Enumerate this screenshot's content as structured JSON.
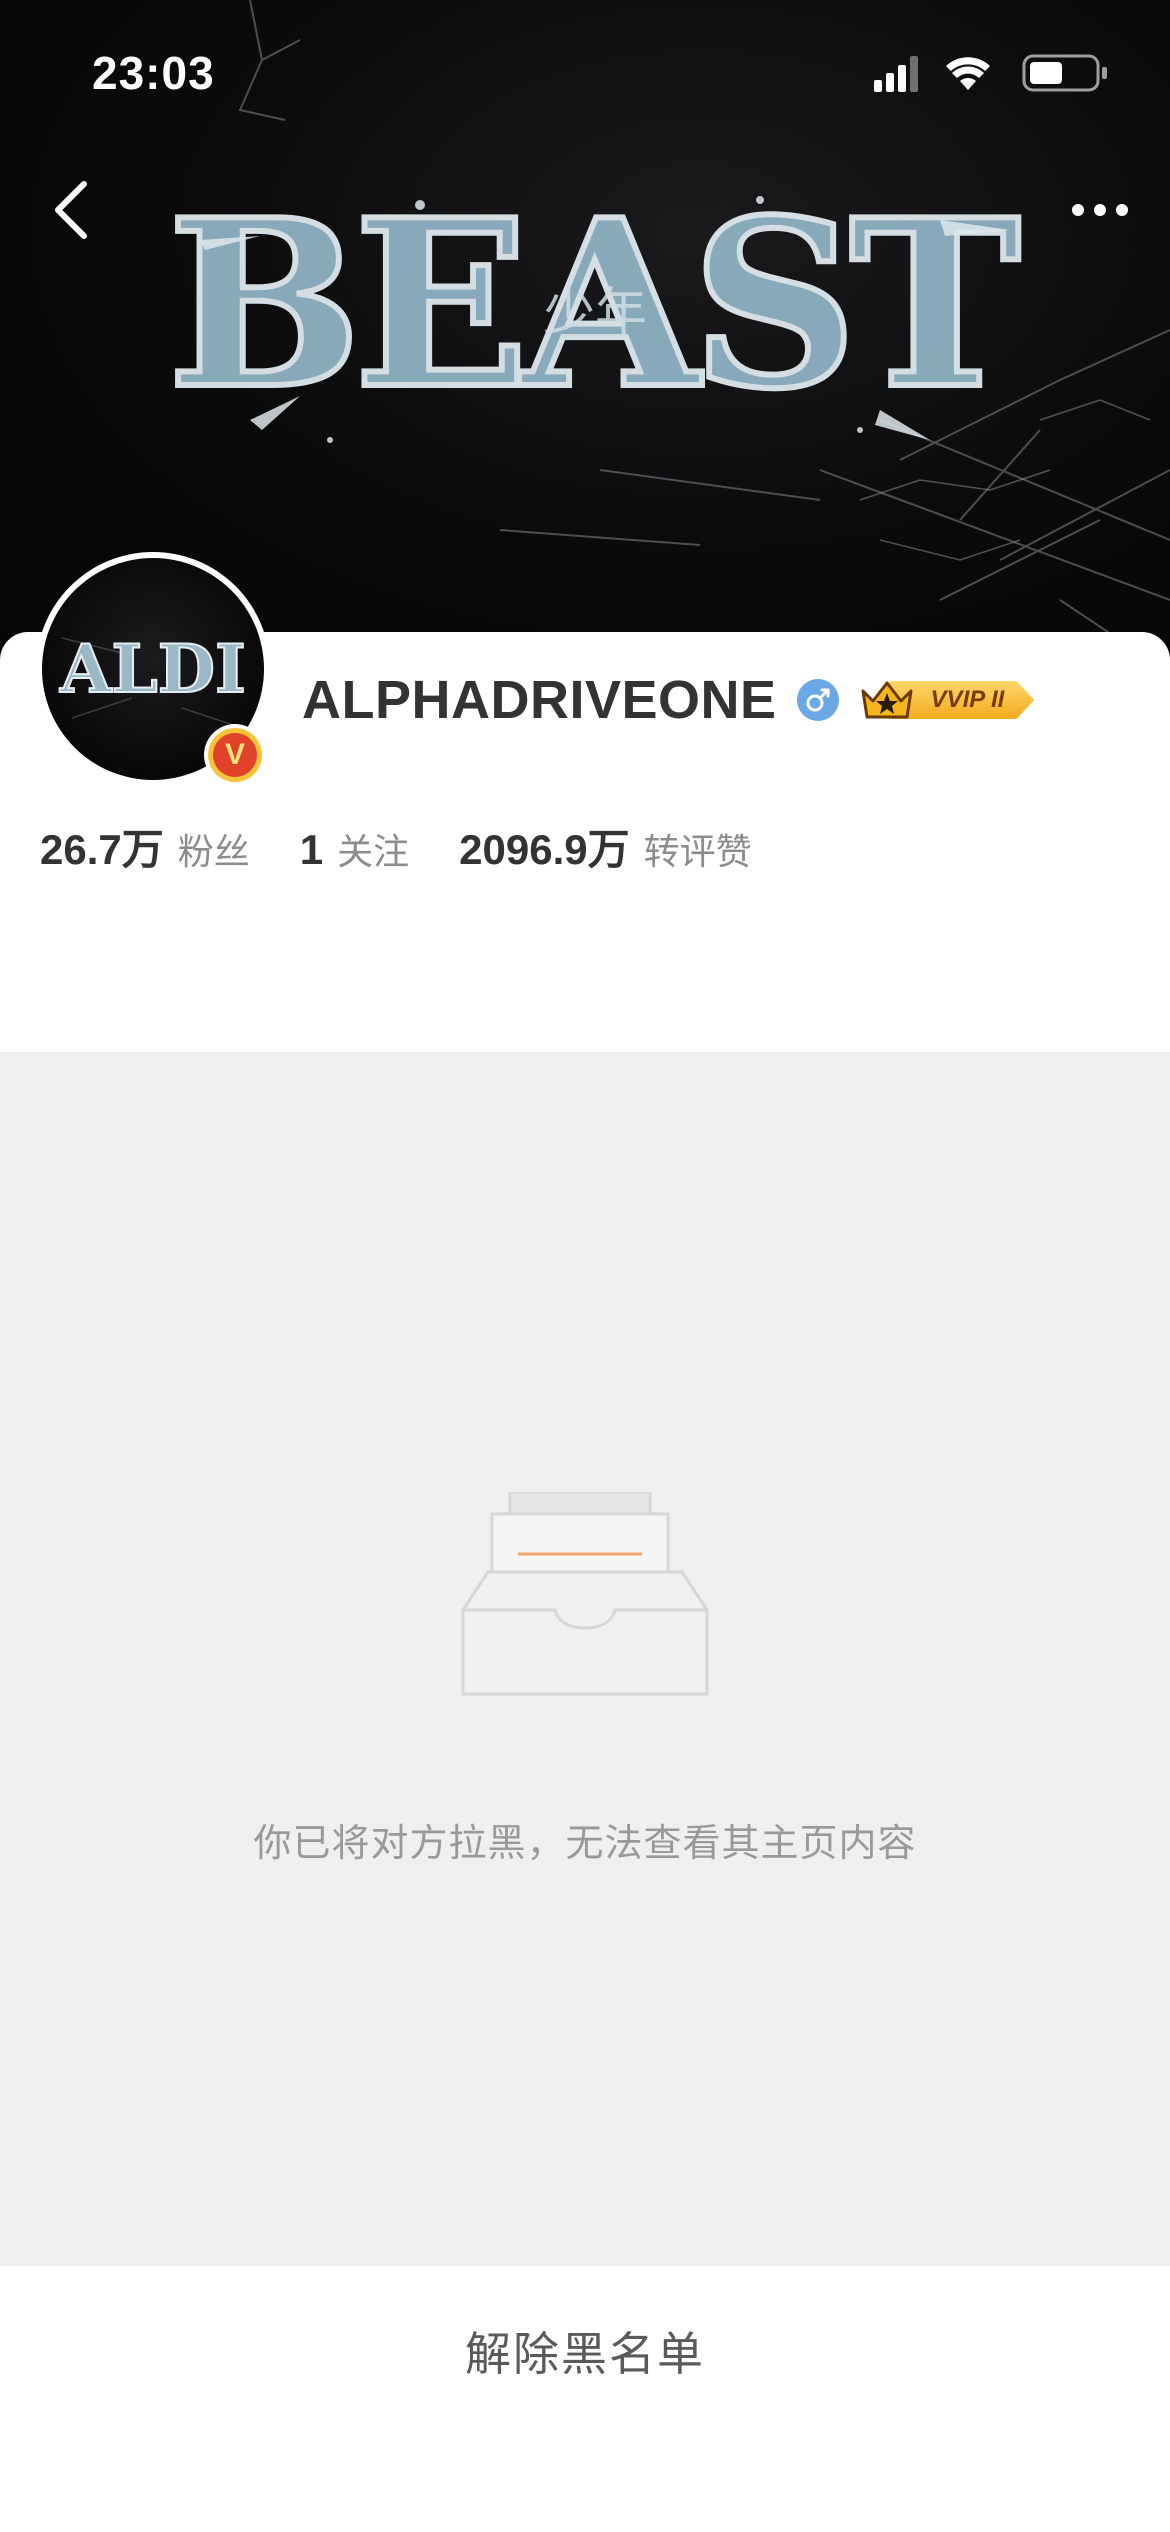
{
  "status_bar": {
    "time": "23:03",
    "icons": [
      "signal-icon",
      "wifi-icon",
      "battery-icon"
    ]
  },
  "nav": {
    "back_icon": "chevron-left-icon",
    "more_icon": "more-dots-icon"
  },
  "banner": {
    "artwork_text": "BEAST",
    "artwork_subtext": "少年"
  },
  "profile": {
    "avatar_text": "ALDI",
    "verified_badge": "V",
    "username": "ALPHADRIVEONE",
    "gender_icon": "male-icon",
    "vip_label": "VVIP II",
    "stats": [
      {
        "value": "26.7万",
        "label": "粉丝"
      },
      {
        "value": "1",
        "label": "关注"
      },
      {
        "value": "2096.9万",
        "label": "转评赞"
      }
    ]
  },
  "blocked": {
    "illustration_icon": "empty-inbox-icon",
    "message": "你已将对方拉黑，无法查看其主页内容"
  },
  "actions": {
    "unblock_label": "解除黑名单"
  },
  "colors": {
    "accent_orange": "#f5a56b",
    "verified_red": "#e2412a",
    "verified_gold": "#f6c43a",
    "gender_blue": "#6aa8e6",
    "vip_gold": "#f3a91e",
    "blocked_bg": "#efefef"
  }
}
